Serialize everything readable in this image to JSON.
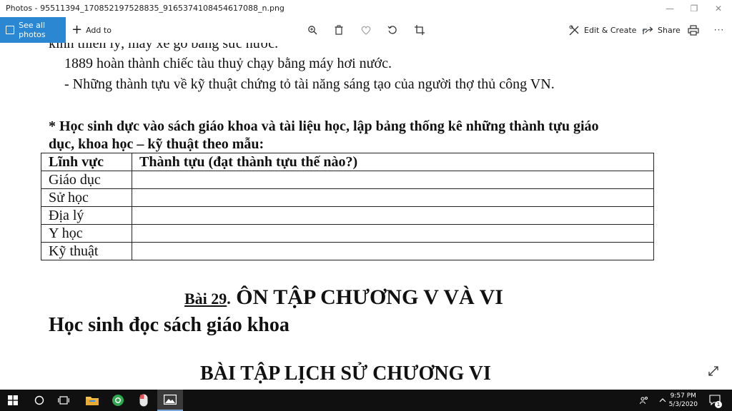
{
  "window": {
    "title": "Photos - 95511394_170852197528835_9165374108454617088_n.png",
    "controls": [
      "—",
      "❐",
      "✕"
    ]
  },
  "toolbar": {
    "see_all": "See all photos",
    "add_to": "Add to",
    "edit_create": "Edit & Create",
    "share": "Share",
    "more": "···",
    "accent": "#2b87d1"
  },
  "document": {
    "line_cut_top": "kinh thiên lý, máy xe gỗ bằng sức nước.",
    "line_1889": "1889 hoàn thành chiếc tàu thuỷ chạy bằng máy hơi nước.",
    "line_achievements": "- Những thành tựu về kỹ thuật chứng tỏ tài năng sáng tạo của người thợ thủ công VN.",
    "task_line1": "* Học sinh dực vào sách giáo khoa và tài liệu học, lập bảng thống kê những thành tựu giáo",
    "task_line2": "dục, khoa học – kỹ thuật theo mẫu:",
    "table": {
      "headers": [
        "Lĩnh vực",
        "Thành tựu (đạt thành tựu thế nào?)"
      ],
      "rows": [
        "Giáo dục",
        "Sử học",
        "Địa lý",
        "Y học",
        "Kỹ thuật"
      ]
    },
    "lesson_label": "Bài 29",
    "lesson_dot": ".",
    "lesson_title": "ÔN TẬP CHƯƠNG V VÀ VI",
    "instruction": "Học sinh đọc sách giáo khoa",
    "bottom_cut": "BÀI TẬP LỊCH SỬ CHƯƠNG VI"
  },
  "taskbar": {
    "time": "9:57 PM",
    "date": "5/3/2020",
    "notification_count": "1"
  }
}
